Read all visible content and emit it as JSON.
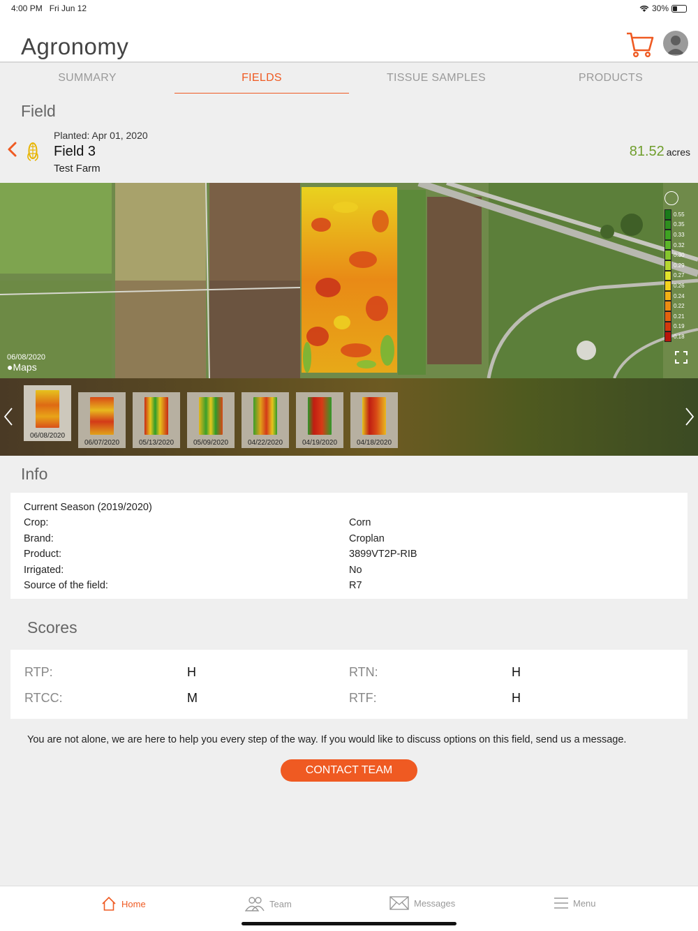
{
  "status": {
    "time": "4:00 PM",
    "date": "Fri Jun 12",
    "battery": "30%"
  },
  "header": {
    "title": "Agronomy"
  },
  "tabs": [
    {
      "label": "SUMMARY",
      "active": false
    },
    {
      "label": "FIELDS",
      "active": true
    },
    {
      "label": "TISSUE SAMPLES",
      "active": false
    },
    {
      "label": "PRODUCTS",
      "active": false
    }
  ],
  "field_section_title": "Field",
  "field": {
    "planted": "Planted:  Apr 01, 2020",
    "name": "Field 3",
    "farm": "Test Farm",
    "acres_value": "81.52",
    "acres_unit": "acres"
  },
  "map": {
    "date": "06/08/2020",
    "provider": "Maps",
    "legend": [
      {
        "value": "0.55",
        "color": "#1a7a1a"
      },
      {
        "value": "0.35",
        "color": "#2e8e1e"
      },
      {
        "value": "0.33",
        "color": "#3ea322"
      },
      {
        "value": "0.32",
        "color": "#5cb52a"
      },
      {
        "value": "0.30",
        "color": "#86c62e"
      },
      {
        "value": "0.29",
        "color": "#b6d630"
      },
      {
        "value": "0.27",
        "color": "#e0e22c"
      },
      {
        "value": "0.26",
        "color": "#f5d21e"
      },
      {
        "value": "0.24",
        "color": "#f2b016"
      },
      {
        "value": "0.22",
        "color": "#ec8c12"
      },
      {
        "value": "0.21",
        "color": "#e2620f"
      },
      {
        "value": "0.19",
        "color": "#d2380d"
      },
      {
        "value": "0.18",
        "color": "#b8150c"
      }
    ]
  },
  "thumbnails": [
    {
      "date": "06/08/2020",
      "selected": true
    },
    {
      "date": "06/07/2020",
      "selected": false
    },
    {
      "date": "05/13/2020",
      "selected": false
    },
    {
      "date": "05/09/2020",
      "selected": false
    },
    {
      "date": "04/22/2020",
      "selected": false
    },
    {
      "date": "04/19/2020",
      "selected": false
    },
    {
      "date": "04/18/2020",
      "selected": false
    }
  ],
  "info": {
    "title": "Info",
    "season": "Current Season (2019/2020)",
    "rows": [
      {
        "label": "Crop:",
        "value": "Corn"
      },
      {
        "label": "Brand:",
        "value": "Croplan"
      },
      {
        "label": "Product:",
        "value": "3899VT2P-RIB"
      },
      {
        "label": "Irrigated:",
        "value": "No"
      },
      {
        "label": "Source of the field:",
        "value": "R7"
      }
    ]
  },
  "scores": {
    "title": "Scores",
    "items": [
      {
        "label": "RTP:",
        "value": "H"
      },
      {
        "label": "RTN:",
        "value": "H"
      },
      {
        "label": "RTCC:",
        "value": "M"
      },
      {
        "label": "RTF:",
        "value": "H"
      }
    ]
  },
  "help_text": "You are not alone, we are here to help you every step of the way. If you would like to discuss options on this field, send us a message.",
  "contact_button": "CONTACT TEAM",
  "bottom_nav": [
    {
      "label": "Home",
      "icon": "home-icon",
      "active": true
    },
    {
      "label": "Team",
      "icon": "team-icon",
      "active": false
    },
    {
      "label": "Messages",
      "icon": "envelope-icon",
      "active": false
    },
    {
      "label": "Menu",
      "icon": "menu-icon",
      "active": false
    }
  ],
  "colors": {
    "accent": "#ef5a22",
    "acres": "#6f9e2c"
  }
}
